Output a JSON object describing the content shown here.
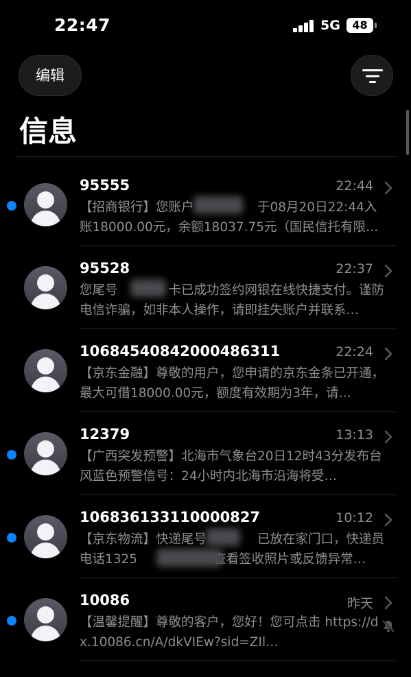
{
  "status_bar": {
    "time": "22:47",
    "network": "5G",
    "battery": "48"
  },
  "header": {
    "edit_label": "编辑",
    "title": "信息"
  },
  "conversations": [
    {
      "sender": "95555",
      "time": "22:44",
      "unread": true,
      "muted": false,
      "preview": "【招商银行】您账户　　　　　于08月20日22:44入账18000.00元，余额18037.75元（国民信托有限公司…"
    },
    {
      "sender": "95528",
      "time": "22:37",
      "unread": false,
      "muted": false,
      "preview": "您尾号　　　　卡已成功签约网银在线快捷支付。谨防电信诈骗，如非本人操作，请即挂失账户并联系…"
    },
    {
      "sender": "1068454084200048631​1",
      "time": "22:24",
      "unread": false,
      "muted": false,
      "preview": "【京东金融】尊敬的用户，您申请的京东金条已开通，最大可借18000.00元，额度有效期为3年，请…"
    },
    {
      "sender": "12379",
      "time": "13:13",
      "unread": true,
      "muted": false,
      "preview": "【广西突发预警】北海市气象台20日12时43分发布台风蓝色预警信号：24小时内北海市沿海将受…"
    },
    {
      "sender": "10683613311000082​7",
      "time": "10:12",
      "unread": true,
      "muted": false,
      "preview": "【京东物流】快递尾号　　　　已放在家门口，快递员电话1325　　　　　　查看签收照片或反馈异常…"
    },
    {
      "sender": "10086",
      "time": "昨天",
      "unread": true,
      "muted": true,
      "preview": "【温馨提醒】尊敬的客户，您好！您可点击 https://dx.10086.cn/A/dkVIEw?sid=ZIl…"
    }
  ]
}
